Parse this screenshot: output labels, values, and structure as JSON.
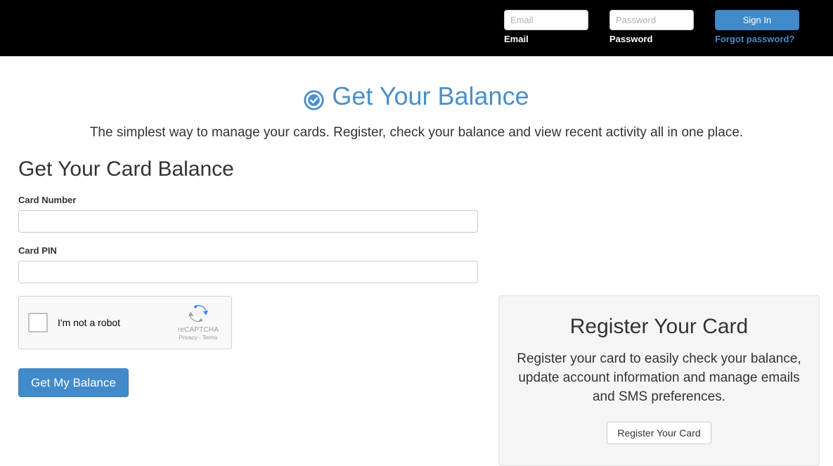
{
  "header": {
    "email": {
      "placeholder": "Email",
      "value": "",
      "label": "Email"
    },
    "password": {
      "placeholder": "Password",
      "value": "",
      "label": "Password"
    },
    "signin_label": "Sign In",
    "forgot_label": "Forgot password?"
  },
  "hero": {
    "icon": "check-circle-icon",
    "title": "Get Your Balance",
    "subtitle": "The simplest way to manage your cards. Register, check your balance and view recent activity all in one place."
  },
  "balance_form": {
    "heading": "Get Your Card Balance",
    "card_number": {
      "label": "Card Number",
      "placeholder": "",
      "value": ""
    },
    "card_pin": {
      "label": "Card PIN",
      "placeholder": "",
      "value": ""
    },
    "recaptcha": {
      "checkbox_label": "I'm not a robot",
      "brand": "reCAPTCHA",
      "terms": "Privacy - Terms",
      "checked": false
    },
    "submit_label": "Get My Balance"
  },
  "register_panel": {
    "title": "Register Your Card",
    "description": "Register your card to easily check your balance, update account information and manage emails and SMS preferences.",
    "button_label": "Register Your Card"
  },
  "colors": {
    "accent_blue": "#428bca",
    "header_background": "#000000",
    "panel_background": "#f5f5f5",
    "page_background": "#ffffff",
    "text": "#333333"
  }
}
